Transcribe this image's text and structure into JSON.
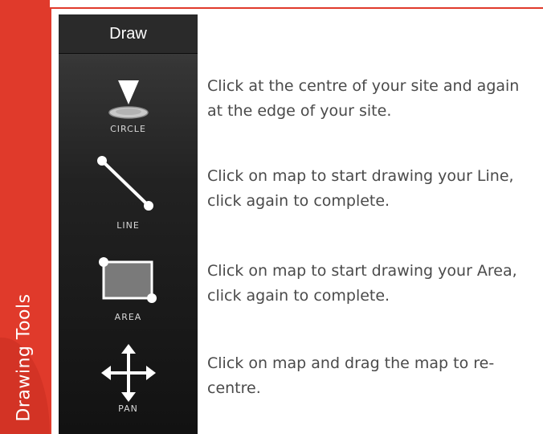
{
  "section_label": "Drawing Tools",
  "toolbar": {
    "title": "Draw",
    "tools": [
      {
        "label": "CIRCLE",
        "icon": "circle-tool-icon",
        "description": "Click at the centre of your site and again at the edge of your site."
      },
      {
        "label": "LINE",
        "icon": "line-tool-icon",
        "description": "Click on map to start drawing your Line, click again to complete."
      },
      {
        "label": "AREA",
        "icon": "area-tool-icon",
        "description": "Click on map to start drawing your Area, click again to complete."
      },
      {
        "label": "PAN",
        "icon": "pan-tool-icon",
        "description": "Click on map and drag the map to re-centre."
      }
    ]
  },
  "colors": {
    "accent": "#e03a2b",
    "toolbar_bg": "#1a1a1a",
    "text": "#4a4a4a"
  }
}
